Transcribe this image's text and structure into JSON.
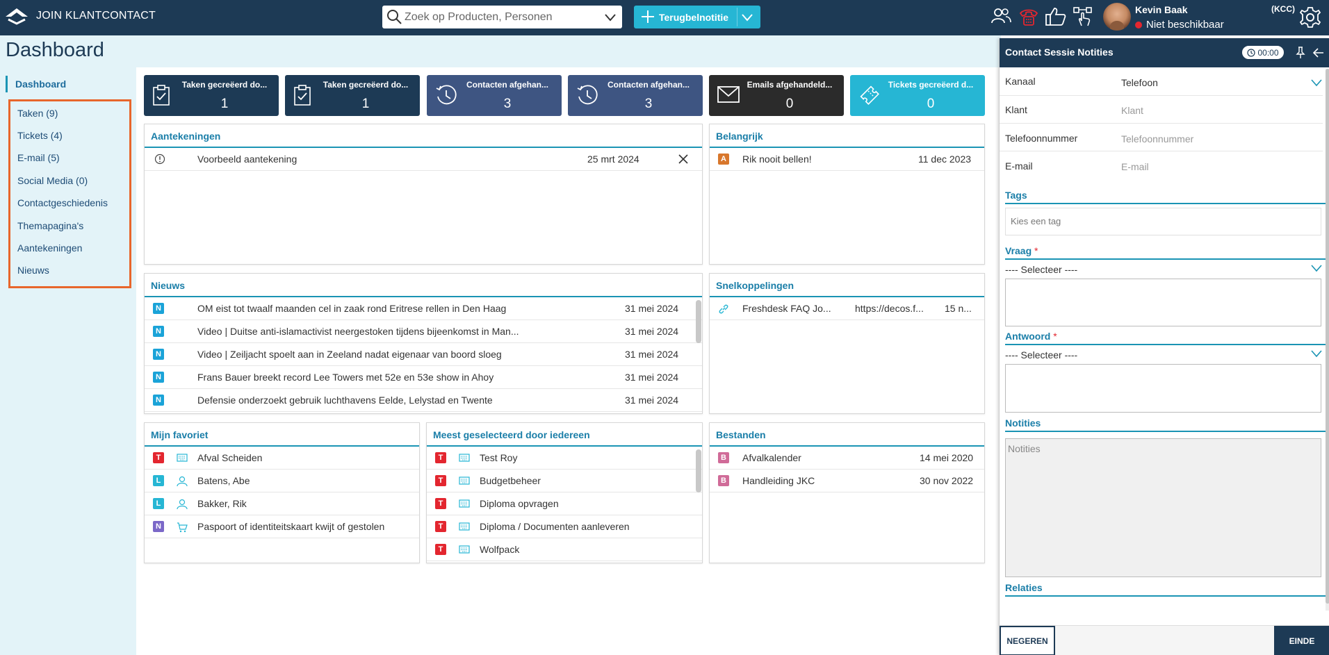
{
  "app": {
    "name": "JOIN KLANTCONTACT"
  },
  "search": {
    "placeholder": "Zoek op Producten, Personen"
  },
  "new_button": {
    "label": "Terugbelnotitie"
  },
  "user": {
    "name": "Kevin Baak",
    "status": "Niet beschikbaar",
    "role": "(KCC)"
  },
  "page": {
    "title": "Dashboard"
  },
  "nav": {
    "active": "Dashboard",
    "items": [
      "Taken (9)",
      "Tickets (4)",
      "E-mail (5)",
      "Social Media (0)",
      "Contactgeschiedenis",
      "Themapagina's",
      "Aantekeningen",
      "Nieuws"
    ]
  },
  "kpis": [
    {
      "label": "Taken gecreëerd do...",
      "value": "1",
      "color": "#1d3a55",
      "icon": "clipboard-check-icon"
    },
    {
      "label": "Taken gecreëerd do...",
      "value": "1",
      "color": "#1d3a55",
      "icon": "clipboard-check-icon"
    },
    {
      "label": "Contacten afgehan...",
      "value": "3",
      "color": "#3e5582",
      "icon": "history-icon"
    },
    {
      "label": "Contacten afgehan...",
      "value": "3",
      "color": "#3e5582",
      "icon": "history-icon"
    },
    {
      "label": "Emails afgehandeld...",
      "value": "0",
      "color": "#2b2b2b",
      "icon": "envelope-icon"
    },
    {
      "label": "Tickets gecreëerd d...",
      "value": "0",
      "color": "#26b6d4",
      "icon": "ticket-icon"
    }
  ],
  "notes_panel": {
    "title": "Aantekeningen",
    "rows": [
      {
        "text": "Voorbeeld aantekening",
        "date": "25 mrt 2024"
      }
    ]
  },
  "important_panel": {
    "title": "Belangrijk",
    "rows": [
      {
        "badge": "A",
        "text": "Rik nooit bellen!",
        "date": "11 dec 2023"
      }
    ]
  },
  "news_panel": {
    "title": "Nieuws",
    "rows": [
      {
        "badge": "N",
        "text": "OM eist tot twaalf maanden cel in zaak rond Eritrese rellen in Den Haag",
        "date": "31 mei 2024"
      },
      {
        "badge": "N",
        "text": "Video | Duitse anti-islamactivist neergestoken tijdens bijeenkomst in Man...",
        "date": "31 mei 2024"
      },
      {
        "badge": "N",
        "text": "Video | Zeiljacht spoelt aan in Zeeland nadat eigenaar van boord sloeg",
        "date": "31 mei 2024"
      },
      {
        "badge": "N",
        "text": "Frans Bauer breekt record Lee Towers met 52e en 53e show in Ahoy",
        "date": "31 mei 2024"
      },
      {
        "badge": "N",
        "text": "Defensie onderzoekt gebruik luchthavens Eelde, Lelystad en Twente",
        "date": "31 mei 2024"
      }
    ]
  },
  "quicklinks_panel": {
    "title": "Snelkoppelingen",
    "rows": [
      {
        "text": "Freshdesk FAQ Jo...",
        "url": "https://decos.f...",
        "date": "15 n..."
      }
    ]
  },
  "favorites_panel": {
    "title": "Mijn favoriet",
    "rows": [
      {
        "badge": "T",
        "icon": "keyboard-icon",
        "text": "Afval Scheiden"
      },
      {
        "badge": "L",
        "icon": "person-icon",
        "text": "Batens, Abe"
      },
      {
        "badge": "L",
        "icon": "person-icon",
        "text": "Bakker, Rik"
      },
      {
        "badge": "N",
        "icon": "cart-icon",
        "text": "Paspoort of identiteitskaart kwijt of gestolen"
      }
    ]
  },
  "popular_panel": {
    "title": "Meest geselecteerd door iedereen",
    "rows": [
      {
        "badge": "T",
        "text": "Test Roy"
      },
      {
        "badge": "T",
        "text": "Budgetbeheer"
      },
      {
        "badge": "T",
        "text": "Diploma opvragen"
      },
      {
        "badge": "T",
        "text": "Diploma / Documenten aanleveren"
      },
      {
        "badge": "T",
        "text": "Wolfpack"
      }
    ]
  },
  "files_panel": {
    "title": "Bestanden",
    "rows": [
      {
        "badge": "B",
        "text": "Afvalkalender",
        "date": "14 mei 2020"
      },
      {
        "badge": "B",
        "text": "Handleiding JKC",
        "date": "30 nov 2022"
      }
    ]
  },
  "session": {
    "title": "Contact Sessie Notities",
    "timer": "00:00",
    "channel_label": "Kanaal",
    "channel_value": "Telefoon",
    "client_label": "Klant",
    "client_placeholder": "Klant",
    "phone_label": "Telefoonnummer",
    "phone_placeholder": "Telefoonnummer",
    "email_label": "E-mail",
    "email_placeholder": "E-mail",
    "tags_label": "Tags",
    "tags_placeholder": "Kies een tag",
    "question_label": "Vraag",
    "question_select": "---- Selecteer ----",
    "answer_label": "Antwoord",
    "answer_select": "---- Selecteer ----",
    "notes_label": "Notities",
    "notes_placeholder": "Notities",
    "relations_label": "Relaties",
    "ignore_button": "NEGEREN",
    "end_button": "EINDE"
  }
}
